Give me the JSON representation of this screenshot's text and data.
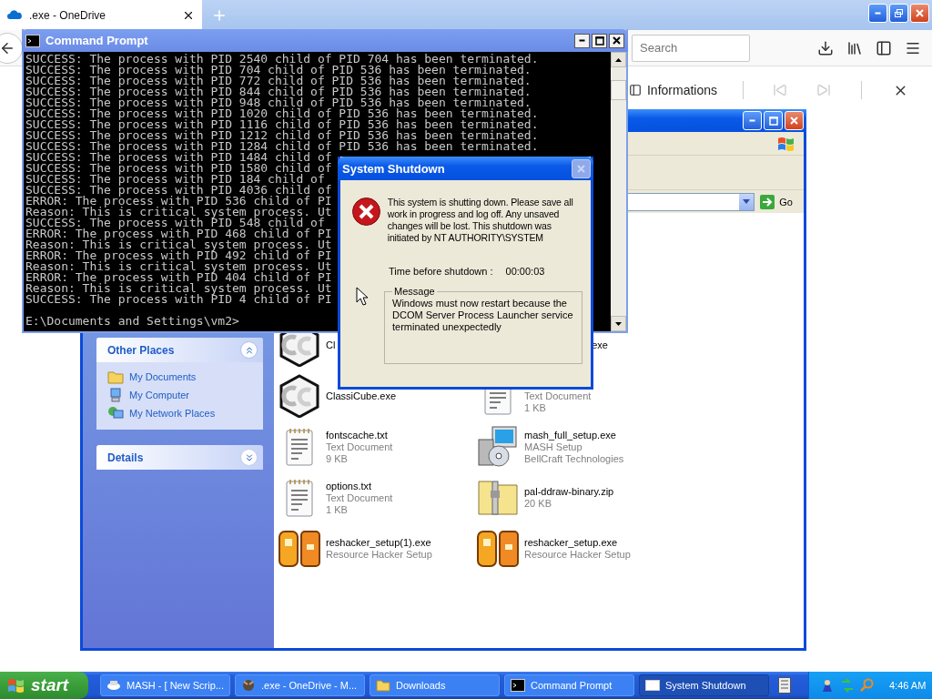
{
  "browser": {
    "tab": {
      "title": ".exe - OneDrive",
      "selected": true
    },
    "search": {
      "placeholder": "Search"
    },
    "sidebar": {
      "title": "Informations"
    }
  },
  "explorer": {
    "go": "Go",
    "panels": [
      {
        "title": "Other Places",
        "expanded": true,
        "links": [
          {
            "label": "My Documents",
            "kind": "documents"
          },
          {
            "label": "My Computer",
            "kind": "computer"
          },
          {
            "label": "My Network Places",
            "kind": "network"
          }
        ]
      },
      {
        "title": "Details",
        "expanded": false
      }
    ],
    "files": [
      {
        "kind": "cc",
        "clipped_start": false,
        "name_hidden": false,
        "lines": [
          "Cl"
        ]
      },
      {
        "kind": "hidden",
        "clipped_start": true,
        "name_hidden": false,
        "lines": [
          "exe"
        ]
      },
      {
        "kind": "cc",
        "clipped_start": false,
        "name_hidden": false,
        "lines": [
          "ClassiCube.exe"
        ]
      },
      {
        "kind": "txt",
        "clipped_start": false,
        "name_hidden": true,
        "lines": [
          "Text Document",
          "1 KB"
        ]
      },
      {
        "kind": "txt",
        "clipped_start": false,
        "name_hidden": false,
        "lines": [
          "fontscache.txt",
          "Text Document",
          "9 KB"
        ]
      },
      {
        "kind": "setup",
        "clipped_start": false,
        "name_hidden": false,
        "lines": [
          "mash_full_setup.exe",
          "MASH Setup",
          "BellCraft Technologies"
        ]
      },
      {
        "kind": "txt",
        "clipped_start": false,
        "name_hidden": false,
        "lines": [
          "options.txt",
          "Text Document",
          "1 KB"
        ]
      },
      {
        "kind": "zip",
        "clipped_start": false,
        "name_hidden": false,
        "lines": [
          "pal-ddraw-binary.zip",
          "20 KB"
        ]
      },
      {
        "kind": "rh",
        "clipped_start": false,
        "name_hidden": false,
        "lines": [
          "reshacker_setup(1).exe",
          "Resource Hacker Setup"
        ]
      },
      {
        "kind": "rh",
        "clipped_start": false,
        "name_hidden": false,
        "lines": [
          "reshacker_setup.exe",
          "Resource Hacker Setup"
        ]
      }
    ]
  },
  "cmd": {
    "title": "Command Prompt",
    "lines": [
      "SUCCESS: The process with PID 2540 child of PID 704 has been terminated.",
      "SUCCESS: The process with PID 704 child of PID 536 has been terminated.",
      "SUCCESS: The process with PID 772 child of PID 536 has been terminated.",
      "SUCCESS: The process with PID 844 child of PID 536 has been terminated.",
      "SUCCESS: The process with PID 948 child of PID 536 has been terminated.",
      "SUCCESS: The process with PID 1020 child of PID 536 has been terminated.",
      "SUCCESS: The process with PID 1116 child of PID 536 has been terminated.",
      "SUCCESS: The process with PID 1212 child of PID 536 has been terminated.",
      "SUCCESS: The process with PID 1284 child of PID 536 has been terminated.",
      "SUCCESS: The process with PID 1484 child of",
      "SUCCESS: The process with PID 1580 child of",
      "SUCCESS: The process with PID 184 child of",
      "SUCCESS: The process with PID 4036 child of",
      "ERROR: The process with PID 536 child of PI",
      "Reason: This is critical system process. Ut",
      "SUCCESS: The process with PID 548 child of",
      "ERROR: The process with PID 468 child of PI",
      "Reason: This is critical system process. Ut",
      "ERROR: The process with PID 492 child of PI",
      "Reason: This is critical system process. Ut",
      "ERROR: The process with PID 404 child of PI",
      "Reason: This is critical system process. Ut",
      "SUCCESS: The process with PID 4 child of PI"
    ],
    "prompt": "E:\\Documents and Settings\\vm2>"
  },
  "dialog": {
    "title": "System Shutdown",
    "close_disabled": true,
    "text": "This system is shutting down. Please save all work in progress and log off. Any unsaved changes will be lost. This shutdown was initiated by NT AUTHORITY\\SYSTEM",
    "time_label": "Time before shutdown :",
    "time": "00:00:03",
    "message_label": "Message",
    "message": "Windows must now restart because the DCOM Server Process Launcher service terminated unexpectedly"
  },
  "taskbar": {
    "start": "start",
    "tasks": [
      {
        "label": "MASH - [ New Scrip...",
        "kind": "mash",
        "selected": false
      },
      {
        "label": ".exe - OneDrive - M...",
        "kind": "browser",
        "selected": false
      },
      {
        "label": "Downloads",
        "kind": "folder",
        "selected": false
      },
      {
        "label": "Command Prompt",
        "kind": "console",
        "selected": false
      },
      {
        "label": "System Shutdown",
        "kind": "window",
        "selected": true
      }
    ],
    "clock": "4:46 AM"
  }
}
